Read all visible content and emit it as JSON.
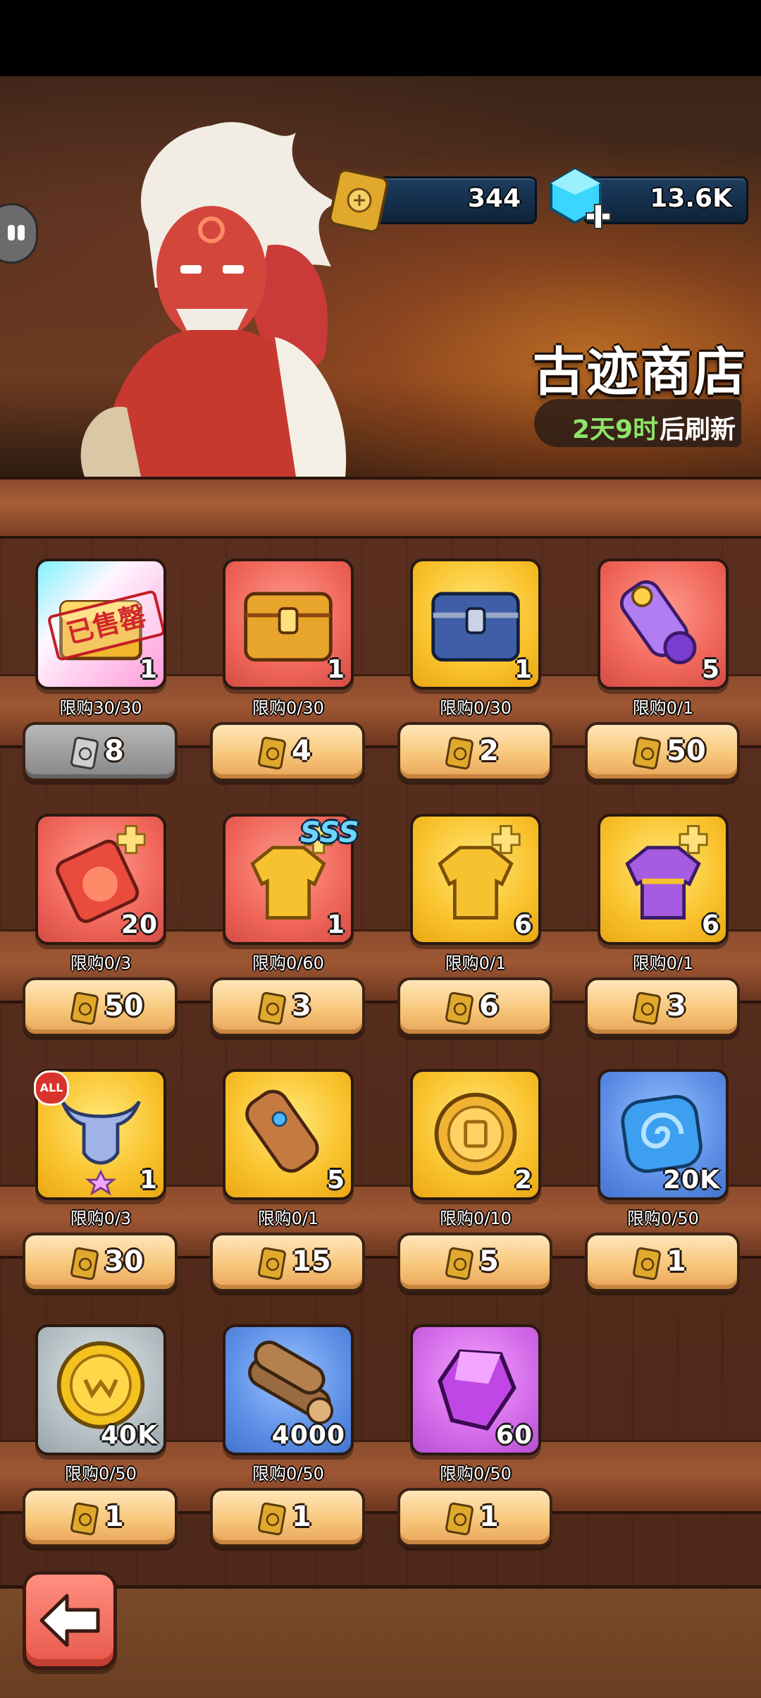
{
  "header": {
    "currency_tablet": "344",
    "currency_gems": "13.6K",
    "shop_title": "古迹商店",
    "refresh_time": "2天9时",
    "refresh_suffix": "后刷新"
  },
  "items": [
    {
      "icon": "golden-chest-icon",
      "bg": "holo",
      "qty": "1",
      "limit": "限购30/30",
      "price": "8",
      "sold_out": true,
      "sold_label": "已售罄"
    },
    {
      "icon": "gold-chest-icon",
      "bg": "red",
      "qty": "1",
      "limit": "限购0/30",
      "price": "4"
    },
    {
      "icon": "blue-chest-icon",
      "bg": "yellow",
      "qty": "1",
      "limit": "限购0/30",
      "price": "2"
    },
    {
      "icon": "purple-scroll-icon",
      "bg": "red",
      "qty": "5",
      "limit": "限购0/1",
      "price": "50"
    },
    {
      "icon": "red-potion-shard-icon",
      "bg": "red",
      "qty": "20",
      "limit": "限购0/3",
      "price": "50"
    },
    {
      "icon": "gold-armor-shard-icon",
      "bg": "red",
      "qty": "1",
      "limit": "限购0/60",
      "price": "3",
      "badge": "SSS"
    },
    {
      "icon": "gold-armor-shard-icon",
      "bg": "yellow",
      "qty": "6",
      "limit": "限购0/1",
      "price": "6"
    },
    {
      "icon": "purple-armor-shard-icon",
      "bg": "yellow",
      "qty": "6",
      "limit": "限购0/1",
      "price": "3"
    },
    {
      "icon": "horned-helmet-icon",
      "bg": "yellow",
      "qty": "1",
      "limit": "限购0/3",
      "price": "30",
      "badge": "ALL"
    },
    {
      "icon": "brown-scroll-icon",
      "bg": "yellow",
      "qty": "5",
      "limit": "限购0/1",
      "price": "15"
    },
    {
      "icon": "gold-medal-icon",
      "bg": "yellow",
      "qty": "2",
      "limit": "限购0/10",
      "price": "5"
    },
    {
      "icon": "blue-swirl-stone-icon",
      "bg": "blue",
      "qty": "20K",
      "limit": "限购0/50",
      "price": "1"
    },
    {
      "icon": "gold-coin-icon",
      "bg": "grey",
      "qty": "40K",
      "limit": "限购0/50",
      "price": "1"
    },
    {
      "icon": "wood-logs-icon",
      "bg": "blue",
      "qty": "4000",
      "limit": "限购0/50",
      "price": "1"
    },
    {
      "icon": "purple-gem-icon",
      "bg": "purple",
      "qty": "60",
      "limit": "限购0/50",
      "price": "1"
    }
  ],
  "colors": {
    "refresh_time_color": "#8fe36a",
    "price_button": "#f7c77b",
    "back_button": "#e8584b"
  }
}
